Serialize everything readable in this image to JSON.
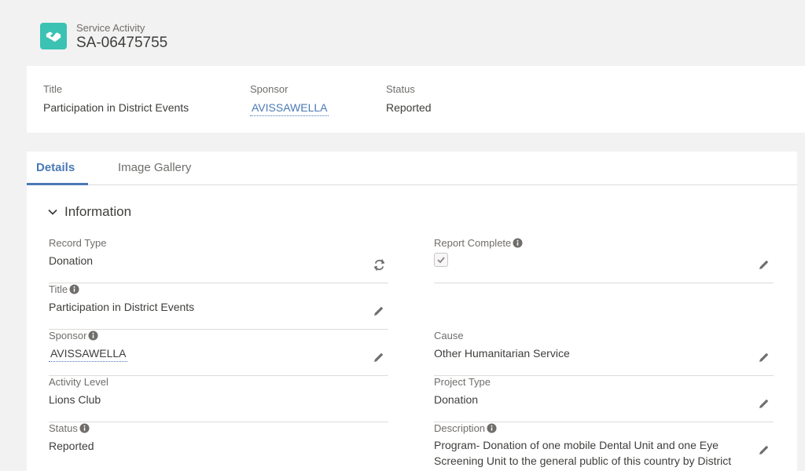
{
  "header": {
    "object_label": "Service Activity",
    "record_name": "SA-06475755",
    "icon": "handshake-icon"
  },
  "highlights": {
    "title_label": "Title",
    "title_value": "Participation in District Events",
    "sponsor_label": "Sponsor",
    "sponsor_value": "AVISSAWELLA",
    "status_label": "Status",
    "status_value": "Reported"
  },
  "tabs": [
    {
      "label": "Details",
      "active": true
    },
    {
      "label": "Image Gallery",
      "active": false
    }
  ],
  "section": {
    "title": "Information",
    "icon": "chevron-down-icon"
  },
  "fields": {
    "record_type": {
      "label": "Record Type",
      "value": "Donation"
    },
    "title": {
      "label": "Title",
      "value": "Participation in District Events"
    },
    "sponsor": {
      "label": "Sponsor",
      "value": "AVISSAWELLA"
    },
    "activity_level": {
      "label": "Activity Level",
      "value": "Lions Club"
    },
    "status": {
      "label": "Status",
      "value": "Reported"
    },
    "report_complete": {
      "label": "Report Complete",
      "checked": true
    },
    "cause": {
      "label": "Cause",
      "value": "Other Humanitarian Service"
    },
    "project_type": {
      "label": "Project Type",
      "value": "Donation"
    },
    "description": {
      "label": "Description",
      "value": "Program- Donation of one mobile Dental Unit and one Eye Screening Unit to the general public of this country by District"
    }
  },
  "colors": {
    "accent": "#4a79b5",
    "app_icon_bg": "#3cc2b3",
    "background": "#f3f2f2"
  }
}
